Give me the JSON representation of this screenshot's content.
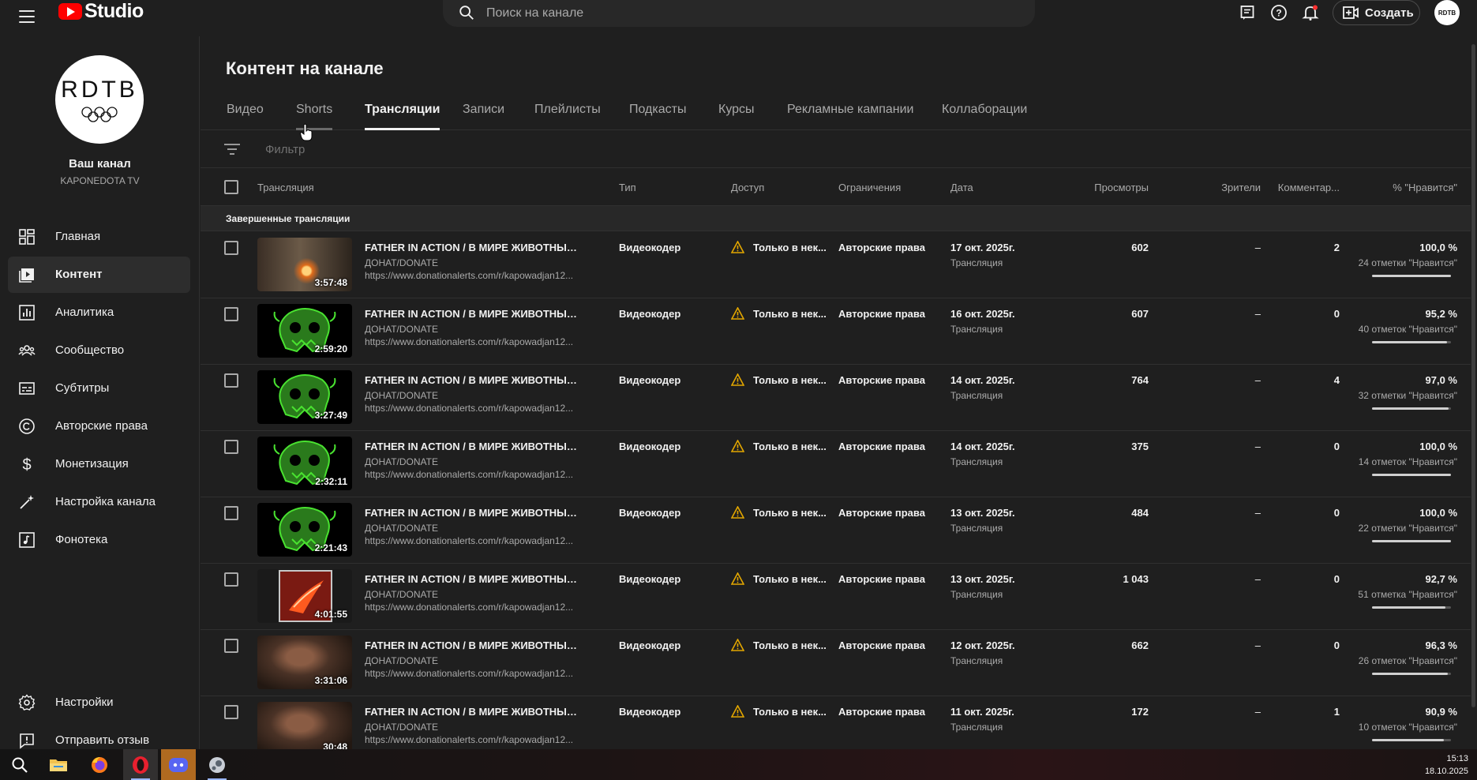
{
  "app": {
    "logo_text": "Studio",
    "search_placeholder": "Поиск на канале",
    "create_label": "Создать",
    "avatar_text": "RDTB"
  },
  "sidebar": {
    "channel_logo_text": "RDTB",
    "channel_title": "Ваш канал",
    "channel_name": "KAPONEDOTA TV",
    "items": [
      {
        "label": "Главная",
        "icon": "dashboard-icon"
      },
      {
        "label": "Контент",
        "icon": "content-icon",
        "active": true
      },
      {
        "label": "Аналитика",
        "icon": "analytics-icon"
      },
      {
        "label": "Сообщество",
        "icon": "community-icon"
      },
      {
        "label": "Субтитры",
        "icon": "subtitles-icon"
      },
      {
        "label": "Авторские права",
        "icon": "copyright-icon"
      },
      {
        "label": "Монетизация",
        "icon": "monetization-icon"
      },
      {
        "label": "Настройка канала",
        "icon": "customization-icon"
      },
      {
        "label": "Фонотека",
        "icon": "audio-library-icon"
      }
    ],
    "bottom_items": [
      {
        "label": "Настройки",
        "icon": "settings-icon"
      },
      {
        "label": "Отправить отзыв",
        "icon": "feedback-icon"
      }
    ]
  },
  "main": {
    "page_title": "Контент на канале",
    "tabs": [
      {
        "label": "Видео"
      },
      {
        "label": "Shorts"
      },
      {
        "label": "Трансляции",
        "active": true
      },
      {
        "label": "Записи"
      },
      {
        "label": "Плейлисты"
      },
      {
        "label": "Подкасты"
      },
      {
        "label": "Курсы"
      },
      {
        "label": "Рекламные кампании"
      },
      {
        "label": "Коллаборации"
      }
    ],
    "filter_placeholder": "Фильтр",
    "columns": {
      "stream": "Трансляция",
      "type": "Тип",
      "access": "Доступ",
      "restrictions": "Ограничения",
      "date": "Дата",
      "views": "Просмотры",
      "viewers": "Зрители",
      "comments": "Комментар...",
      "likes": "% \"Нравится\""
    },
    "section_label": "Завершенные трансляции",
    "rows": [
      {
        "thumb": "fire",
        "duration": "3:57:48",
        "title": "FATHER IN ACTION / В МИРЕ ЖИВОТНЫХ НА ...",
        "desc1": "ДОНАТ/DONATE",
        "desc2": "https://www.donationalerts.com/r/kapowadjan12...",
        "type": "Видеокодер",
        "access": "Только в нек...",
        "restrictions": "Авторские права",
        "date": "17 окт. 2025г.",
        "date_sub": "Трансляция",
        "views": "602",
        "viewers": "–",
        "comments": "2",
        "likes_pct": "100,0 %",
        "likes_cnt": "24 отметки \"Нравится\"",
        "likes_ratio": 1.0
      },
      {
        "thumb": "skull",
        "duration": "2:59:20",
        "title": "FATHER IN ACTION / В МИРЕ ЖИВОТНЫХ НА ...",
        "desc1": "ДОНАТ/DONATE",
        "desc2": "https://www.donationalerts.com/r/kapowadjan12...",
        "type": "Видеокодер",
        "access": "Только в нек...",
        "restrictions": "Авторские права",
        "date": "16 окт. 2025г.",
        "date_sub": "Трансляция",
        "views": "607",
        "viewers": "–",
        "comments": "0",
        "likes_pct": "95,2 %",
        "likes_cnt": "40 отметок \"Нравится\"",
        "likes_ratio": 0.952
      },
      {
        "thumb": "skull",
        "duration": "3:27:49",
        "title": "FATHER IN ACTION / В МИРЕ ЖИВОТНЫХ НА ...",
        "desc1": "ДОНАТ/DONATE",
        "desc2": "https://www.donationalerts.com/r/kapowadjan12...",
        "type": "Видеокодер",
        "access": "Только в нек...",
        "restrictions": "Авторские права",
        "date": "14 окт. 2025г.",
        "date_sub": "Трансляция",
        "views": "764",
        "viewers": "–",
        "comments": "4",
        "likes_pct": "97,0 %",
        "likes_cnt": "32 отметки \"Нравится\"",
        "likes_ratio": 0.97
      },
      {
        "thumb": "skull",
        "duration": "2:32:11",
        "title": "FATHER IN ACTION / В МИРЕ ЖИВОТНЫХ НА ...",
        "desc1": "ДОНАТ/DONATE",
        "desc2": "https://www.donationalerts.com/r/kapowadjan12...",
        "type": "Видеокодер",
        "access": "Только в нек...",
        "restrictions": "Авторские права",
        "date": "14 окт. 2025г.",
        "date_sub": "Трансляция",
        "views": "375",
        "viewers": "–",
        "comments": "0",
        "likes_pct": "100,0 %",
        "likes_cnt": "14 отметок \"Нравится\"",
        "likes_ratio": 1.0
      },
      {
        "thumb": "skull",
        "duration": "2:21:43",
        "title": "FATHER IN ACTION / В МИРЕ ЖИВОТНЫХ НА ...",
        "desc1": "ДОНАТ/DONATE",
        "desc2": "https://www.donationalerts.com/r/kapowadjan12...",
        "type": "Видеокодер",
        "access": "Только в нек...",
        "restrictions": "Авторские права",
        "date": "13 окт. 2025г.",
        "date_sub": "Трансляция",
        "views": "484",
        "viewers": "–",
        "comments": "0",
        "likes_pct": "100,0 %",
        "likes_cnt": "22 отметки \"Нравится\"",
        "likes_ratio": 1.0
      },
      {
        "thumb": "art",
        "duration": "4:01:55",
        "title": "FATHER IN ACTION / В МИРЕ ЖИВОТНЫХ НА ...",
        "desc1": "ДОНАТ/DONATE",
        "desc2": "https://www.donationalerts.com/r/kapowadjan12...",
        "type": "Видеокодер",
        "access": "Только в нек...",
        "restrictions": "Авторские права",
        "date": "13 окт. 2025г.",
        "date_sub": "Трансляция",
        "views": "1 043",
        "viewers": "–",
        "comments": "0",
        "likes_pct": "92,7 %",
        "likes_cnt": "51 отметка \"Нравится\"",
        "likes_ratio": 0.927
      },
      {
        "thumb": "man",
        "duration": "3:31:06",
        "title": "FATHER IN ACTION / В МИРЕ ЖИВОТНЫХ НА ...",
        "desc1": "ДОНАТ/DONATE",
        "desc2": "https://www.donationalerts.com/r/kapowadjan12...",
        "type": "Видеокодер",
        "access": "Только в нек...",
        "restrictions": "Авторские права",
        "date": "12 окт. 2025г.",
        "date_sub": "Трансляция",
        "views": "662",
        "viewers": "–",
        "comments": "0",
        "likes_pct": "96,3 %",
        "likes_cnt": "26 отметок \"Нравится\"",
        "likes_ratio": 0.963
      },
      {
        "thumb": "man",
        "duration": "30:48",
        "title": "FATHER IN ACTION / В МИРЕ ЖИВОТНЫХ НА ...",
        "desc1": "ДОНАТ/DONATE",
        "desc2": "https://www.donationalerts.com/r/kapowadjan12...",
        "type": "Видеокодер",
        "access": "Только в нек...",
        "restrictions": "Авторские права",
        "date": "11 окт. 2025г.",
        "date_sub": "Трансляция",
        "views": "172",
        "viewers": "–",
        "comments": "1",
        "likes_pct": "90,9 %",
        "likes_cnt": "10 отметок \"Нравится\"",
        "likes_ratio": 0.909
      }
    ]
  },
  "taskbar": {
    "apps": [
      "search-icon",
      "file-explorer-icon",
      "firefox-icon",
      "opera-icon",
      "discord-icon",
      "steam-icon"
    ],
    "time": "15:13",
    "date": "18.10.2025"
  },
  "colors": {
    "brand_red": "#ff0000",
    "background": "#1f1f1f",
    "warning": "#e2a600",
    "skull_green": "#3fd82a"
  }
}
